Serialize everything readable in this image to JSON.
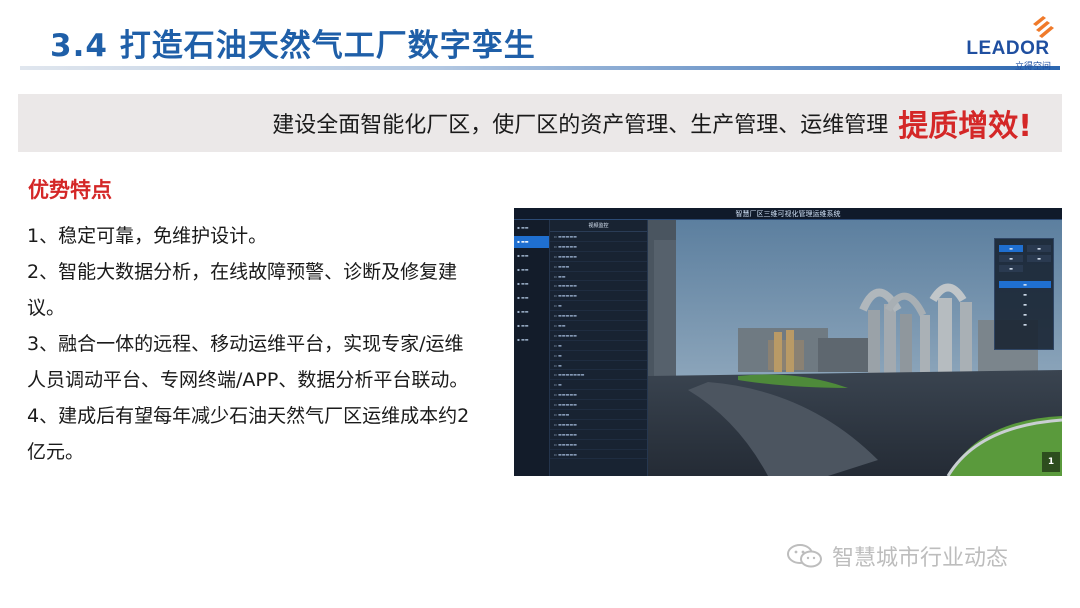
{
  "header": {
    "title": "3.4  打造石油天然气工厂数字孪生",
    "logo_text": "LEADOR",
    "logo_sub": "立得空间",
    "logo_color": "#1f4fa0",
    "accent_color": "#f07a2a"
  },
  "banner": {
    "text": "建设全面智能化厂区，使厂区的资产管理、生产管理、运维管理",
    "highlight": "提质增效!",
    "highlight_color": "#d42727"
  },
  "section": {
    "title": "优势特点",
    "points": [
      "1、稳定可靠，免维护设计。",
      "2、智能大数据分析，在线故障预警、诊断及修复建议。",
      "3、融合一体的远程、移动运维平台，实现专家/运维人员调动平台、专网终端/APP、数据分析平台联动。",
      "4、建成后有望每年减少石油天然气厂区运维成本约2亿元。"
    ]
  },
  "screenshot": {
    "title": "智慧厂区三维可视化管理运维系统",
    "list_header": "视频监控",
    "counter": "1"
  },
  "watermark": {
    "text": "智慧城市行业动态",
    "icon": "wechat-icon"
  }
}
